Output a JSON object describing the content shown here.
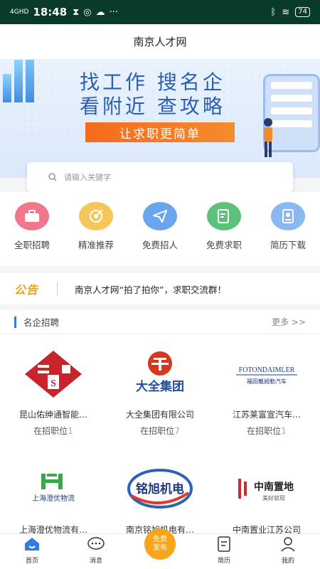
{
  "status": {
    "signal": "4GHD",
    "time": "18:48",
    "battery": "74"
  },
  "header": {
    "title": "南京人才网"
  },
  "banner": {
    "line1": "找工作  搜名企",
    "line2": "看附近  查攻略",
    "slogan": "让求职更简单"
  },
  "search": {
    "placeholder": "请输入关键字"
  },
  "categories": [
    {
      "label": "全职招聘",
      "color": "#f0788a",
      "icon": "briefcase-icon"
    },
    {
      "label": "精准推荐",
      "color": "#f5c65a",
      "icon": "target-icon"
    },
    {
      "label": "免费招人",
      "color": "#6aa6ee",
      "icon": "paper-plane-icon"
    },
    {
      "label": "免费求职",
      "color": "#5cc27a",
      "icon": "resume-send-icon"
    },
    {
      "label": "简历下载",
      "color": "#8ab9f2",
      "icon": "resume-download-icon"
    }
  ],
  "notice": {
    "tag": "公告",
    "text": "南京人才网“拍了拍你”，求职交流群！"
  },
  "section": {
    "title": "名企招聘",
    "more": "更多 >>"
  },
  "companies": [
    {
      "name": "昆山佑绅通智能…",
      "jobs_label": "在招职位",
      "jobs_count": "1",
      "logo_text": "S"
    },
    {
      "name": "大全集团有限公司",
      "jobs_label": "在招职位",
      "jobs_count": "7",
      "logo_text": "大全集团"
    },
    {
      "name": "江苏莱富宣汽车…",
      "jobs_label": "在招职位",
      "jobs_count": "1",
      "logo_text": "FOTONDAIMLER",
      "logo_sub": "福田戴姆勒汽车"
    },
    {
      "name": "上海澄优物流有…",
      "jobs_label": "",
      "jobs_count": "",
      "logo_text": "上海澄优物流"
    },
    {
      "name": "南京铭旭机电有…",
      "jobs_label": "",
      "jobs_count": "",
      "logo_text": "铭旭机电"
    },
    {
      "name": "中南置业江苏公司",
      "jobs_label": "",
      "jobs_count": "",
      "logo_text": "中南置地",
      "logo_sub": "美好就现"
    }
  ],
  "tabs": [
    {
      "label": "首页",
      "icon": "home-icon"
    },
    {
      "label": "消息",
      "icon": "message-icon"
    },
    {
      "label": "",
      "icon": "publish-icon",
      "publish": "免费发布"
    },
    {
      "label": "简历",
      "icon": "resume-icon"
    },
    {
      "label": "我的",
      "icon": "user-icon"
    }
  ]
}
